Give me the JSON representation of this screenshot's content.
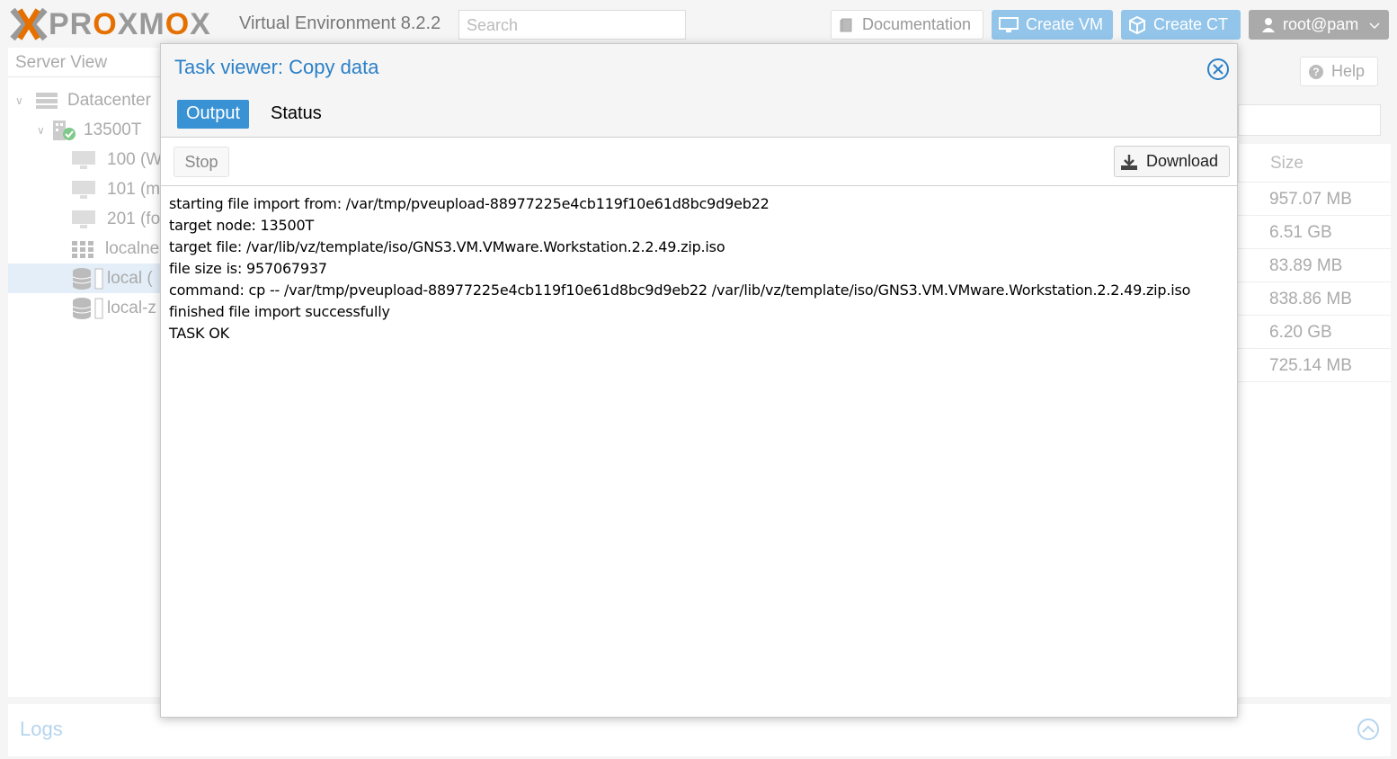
{
  "topbar": {
    "logo_text": "PROXMOX",
    "product": "Virtual Environment 8.2.2",
    "search_placeholder": "Search",
    "doc_label": "Documentation",
    "create_vm_label": "Create VM",
    "create_ct_label": "Create CT",
    "user_label": "root@pam"
  },
  "sidebar": {
    "view": "Server View",
    "items": [
      {
        "label": "Datacenter",
        "icon": "server-rack-icon"
      },
      {
        "label": "13500T",
        "icon": "node-online-icon"
      },
      {
        "label": "100 (W",
        "icon": "vm-monitor-icon"
      },
      {
        "label": "101 (m",
        "icon": "vm-monitor-icon"
      },
      {
        "label": "201 (fo",
        "icon": "vm-monitor-icon"
      },
      {
        "label": "localne",
        "icon": "network-grid-icon"
      },
      {
        "label": "local (",
        "icon": "storage-icon"
      },
      {
        "label": "local-z",
        "icon": "storage-icon"
      }
    ]
  },
  "right_panel": {
    "help_label": "Help",
    "size_header": "Size",
    "sizes": [
      "957.07 MB",
      "6.51 GB",
      "83.89 MB",
      "838.86 MB",
      "6.20 GB",
      "725.14 MB"
    ]
  },
  "logs": {
    "title": "Logs"
  },
  "modal": {
    "title": "Task viewer: Copy data",
    "tabs": {
      "output": "Output",
      "status": "Status"
    },
    "stop_label": "Stop",
    "download_label": "Download",
    "lines": [
      "starting file import from: /var/tmp/pveupload-88977225e4cb119f10e61d8bc9d9eb22",
      "target node: 13500T",
      "target file: /var/lib/vz/template/iso/GNS3.VM.VMware.Workstation.2.2.49.zip.iso",
      "file size is: 957067937",
      "command: cp -- /var/tmp/pveupload-88977225e4cb119f10e61d8bc9d9eb22 /var/lib/vz/template/iso/GNS3.VM.VMware.Workstation.2.2.49.zip.iso",
      "finished file import successfully",
      "TASK OK"
    ]
  },
  "colors": {
    "accent": "#3892d4",
    "brand_orange": "#e57000",
    "title_blue": "#2c80c7"
  }
}
